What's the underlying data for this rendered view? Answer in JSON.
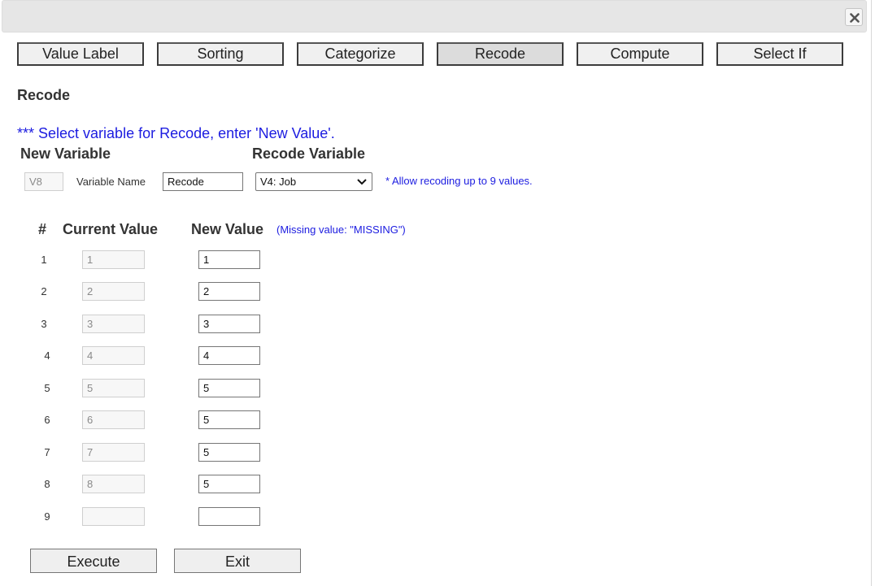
{
  "tabs": [
    {
      "label": "Value Label",
      "active": false
    },
    {
      "label": "Sorting",
      "active": false
    },
    {
      "label": "Categorize",
      "active": false
    },
    {
      "label": "Recode",
      "active": true
    },
    {
      "label": "Compute",
      "active": false
    },
    {
      "label": "Select If",
      "active": false
    }
  ],
  "section_title": "Recode",
  "instruction": "*** Select variable for Recode, enter 'New Value'.",
  "new_variable": {
    "header": "New Variable",
    "id_value": "V8",
    "name_label": "Variable Name",
    "name_value": "Recode"
  },
  "recode_variable": {
    "header": "Recode Variable",
    "selected": "V4: Job",
    "note": "* Allow recoding up to 9 values."
  },
  "table": {
    "num_header": "#",
    "current_header": "Current Value",
    "new_header": "New Value",
    "missing_note": "(Missing value: \"MISSING\")",
    "rows": [
      {
        "num": "1",
        "current": "1",
        "new": "1"
      },
      {
        "num": "2",
        "current": "2",
        "new": "2"
      },
      {
        "num": "3",
        "current": "3",
        "new": "3"
      },
      {
        "num": "4",
        "current": "4",
        "new": "4"
      },
      {
        "num": "5",
        "current": "5",
        "new": "5"
      },
      {
        "num": "6",
        "current": "6",
        "new": "5"
      },
      {
        "num": "7",
        "current": "7",
        "new": "5"
      },
      {
        "num": "8",
        "current": "8",
        "new": "5"
      },
      {
        "num": "9",
        "current": "",
        "new": ""
      }
    ]
  },
  "buttons": {
    "execute": "Execute",
    "exit": "Exit"
  },
  "icons": {
    "close": "close-icon",
    "dropdown": "chevron-down-icon"
  },
  "colors": {
    "instruction_text": "#1c1ce0",
    "active_tab": "#dcdcdc",
    "titlebar": "#e6e6e6"
  }
}
